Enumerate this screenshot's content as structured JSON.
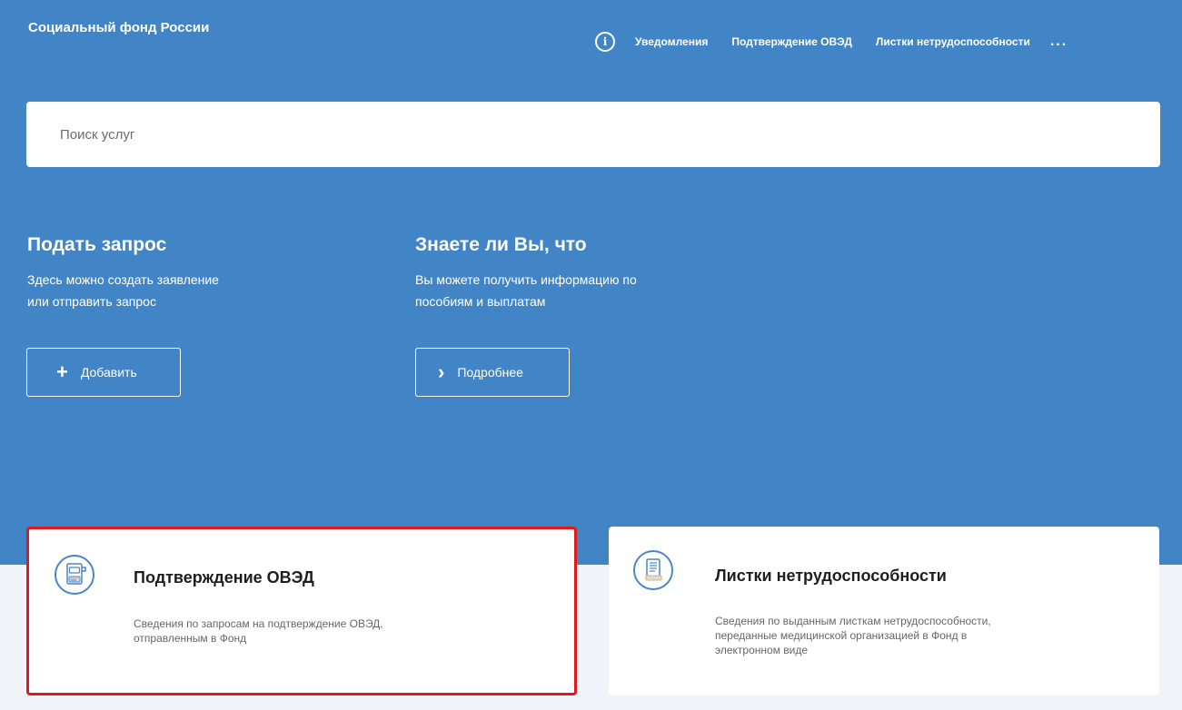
{
  "header": {
    "brand": "Социальный фонд России",
    "nav": [
      "Уведомления",
      "Подтверждение ОВЭД",
      "Листки нетрудоспособности"
    ],
    "more": "...",
    "info_icon_glyph": "i"
  },
  "search": {
    "placeholder": "Поиск услуг"
  },
  "request_block": {
    "title": "Подать запрос",
    "line1": "Здесь можно создать заявление",
    "line2": "или отправить запрос",
    "button_label": "Добавить",
    "button_glyph": "+"
  },
  "info_block": {
    "title": "Знаете ли Вы, что",
    "line1": "Вы можете получить информацию по",
    "line2": "пособиям и выплатам",
    "button_label": "Подробнее",
    "button_glyph": "›"
  },
  "cards": [
    {
      "title": "Подтверждение ОВЭД",
      "desc_line1": "Сведения по запросам на подтверждение ОВЭД,",
      "desc_line2": "отправленным в Фонд",
      "icon": "document-code-icon"
    },
    {
      "title": "Листки нетрудоспособности",
      "desc_line1": "Сведения по выданным листкам нетрудоспособности,",
      "desc_line2": "переданные медицинской организацией в Фонд в",
      "desc_line3": "электронном виде",
      "icon": "document-list-icon"
    }
  ],
  "colors": {
    "hero_bg": "#4285c7",
    "page_bg": "#f1f5fa",
    "highlight_border": "#e01a1a",
    "icon_accent": "#4a86c5"
  }
}
